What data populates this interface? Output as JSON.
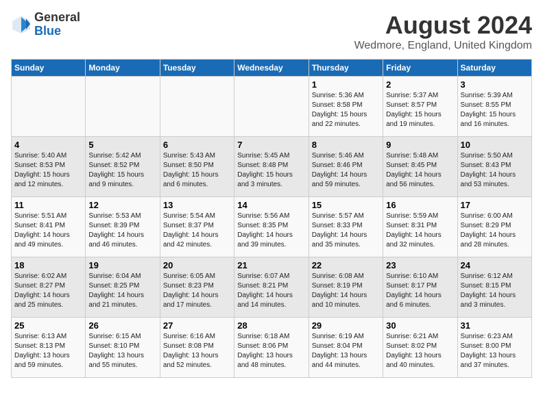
{
  "header": {
    "logo_general": "General",
    "logo_blue": "Blue",
    "month_year": "August 2024",
    "location": "Wedmore, England, United Kingdom"
  },
  "days_of_week": [
    "Sunday",
    "Monday",
    "Tuesday",
    "Wednesday",
    "Thursday",
    "Friday",
    "Saturday"
  ],
  "weeks": [
    [
      {
        "day": "",
        "info": ""
      },
      {
        "day": "",
        "info": ""
      },
      {
        "day": "",
        "info": ""
      },
      {
        "day": "",
        "info": ""
      },
      {
        "day": "1",
        "info": "Sunrise: 5:36 AM\nSunset: 8:58 PM\nDaylight: 15 hours\nand 22 minutes."
      },
      {
        "day": "2",
        "info": "Sunrise: 5:37 AM\nSunset: 8:57 PM\nDaylight: 15 hours\nand 19 minutes."
      },
      {
        "day": "3",
        "info": "Sunrise: 5:39 AM\nSunset: 8:55 PM\nDaylight: 15 hours\nand 16 minutes."
      }
    ],
    [
      {
        "day": "4",
        "info": "Sunrise: 5:40 AM\nSunset: 8:53 PM\nDaylight: 15 hours\nand 12 minutes."
      },
      {
        "day": "5",
        "info": "Sunrise: 5:42 AM\nSunset: 8:52 PM\nDaylight: 15 hours\nand 9 minutes."
      },
      {
        "day": "6",
        "info": "Sunrise: 5:43 AM\nSunset: 8:50 PM\nDaylight: 15 hours\nand 6 minutes."
      },
      {
        "day": "7",
        "info": "Sunrise: 5:45 AM\nSunset: 8:48 PM\nDaylight: 15 hours\nand 3 minutes."
      },
      {
        "day": "8",
        "info": "Sunrise: 5:46 AM\nSunset: 8:46 PM\nDaylight: 14 hours\nand 59 minutes."
      },
      {
        "day": "9",
        "info": "Sunrise: 5:48 AM\nSunset: 8:45 PM\nDaylight: 14 hours\nand 56 minutes."
      },
      {
        "day": "10",
        "info": "Sunrise: 5:50 AM\nSunset: 8:43 PM\nDaylight: 14 hours\nand 53 minutes."
      }
    ],
    [
      {
        "day": "11",
        "info": "Sunrise: 5:51 AM\nSunset: 8:41 PM\nDaylight: 14 hours\nand 49 minutes."
      },
      {
        "day": "12",
        "info": "Sunrise: 5:53 AM\nSunset: 8:39 PM\nDaylight: 14 hours\nand 46 minutes."
      },
      {
        "day": "13",
        "info": "Sunrise: 5:54 AM\nSunset: 8:37 PM\nDaylight: 14 hours\nand 42 minutes."
      },
      {
        "day": "14",
        "info": "Sunrise: 5:56 AM\nSunset: 8:35 PM\nDaylight: 14 hours\nand 39 minutes."
      },
      {
        "day": "15",
        "info": "Sunrise: 5:57 AM\nSunset: 8:33 PM\nDaylight: 14 hours\nand 35 minutes."
      },
      {
        "day": "16",
        "info": "Sunrise: 5:59 AM\nSunset: 8:31 PM\nDaylight: 14 hours\nand 32 minutes."
      },
      {
        "day": "17",
        "info": "Sunrise: 6:00 AM\nSunset: 8:29 PM\nDaylight: 14 hours\nand 28 minutes."
      }
    ],
    [
      {
        "day": "18",
        "info": "Sunrise: 6:02 AM\nSunset: 8:27 PM\nDaylight: 14 hours\nand 25 minutes."
      },
      {
        "day": "19",
        "info": "Sunrise: 6:04 AM\nSunset: 8:25 PM\nDaylight: 14 hours\nand 21 minutes."
      },
      {
        "day": "20",
        "info": "Sunrise: 6:05 AM\nSunset: 8:23 PM\nDaylight: 14 hours\nand 17 minutes."
      },
      {
        "day": "21",
        "info": "Sunrise: 6:07 AM\nSunset: 8:21 PM\nDaylight: 14 hours\nand 14 minutes."
      },
      {
        "day": "22",
        "info": "Sunrise: 6:08 AM\nSunset: 8:19 PM\nDaylight: 14 hours\nand 10 minutes."
      },
      {
        "day": "23",
        "info": "Sunrise: 6:10 AM\nSunset: 8:17 PM\nDaylight: 14 hours\nand 6 minutes."
      },
      {
        "day": "24",
        "info": "Sunrise: 6:12 AM\nSunset: 8:15 PM\nDaylight: 14 hours\nand 3 minutes."
      }
    ],
    [
      {
        "day": "25",
        "info": "Sunrise: 6:13 AM\nSunset: 8:13 PM\nDaylight: 13 hours\nand 59 minutes."
      },
      {
        "day": "26",
        "info": "Sunrise: 6:15 AM\nSunset: 8:10 PM\nDaylight: 13 hours\nand 55 minutes."
      },
      {
        "day": "27",
        "info": "Sunrise: 6:16 AM\nSunset: 8:08 PM\nDaylight: 13 hours\nand 52 minutes."
      },
      {
        "day": "28",
        "info": "Sunrise: 6:18 AM\nSunset: 8:06 PM\nDaylight: 13 hours\nand 48 minutes."
      },
      {
        "day": "29",
        "info": "Sunrise: 6:19 AM\nSunset: 8:04 PM\nDaylight: 13 hours\nand 44 minutes."
      },
      {
        "day": "30",
        "info": "Sunrise: 6:21 AM\nSunset: 8:02 PM\nDaylight: 13 hours\nand 40 minutes."
      },
      {
        "day": "31",
        "info": "Sunrise: 6:23 AM\nSunset: 8:00 PM\nDaylight: 13 hours\nand 37 minutes."
      }
    ]
  ]
}
